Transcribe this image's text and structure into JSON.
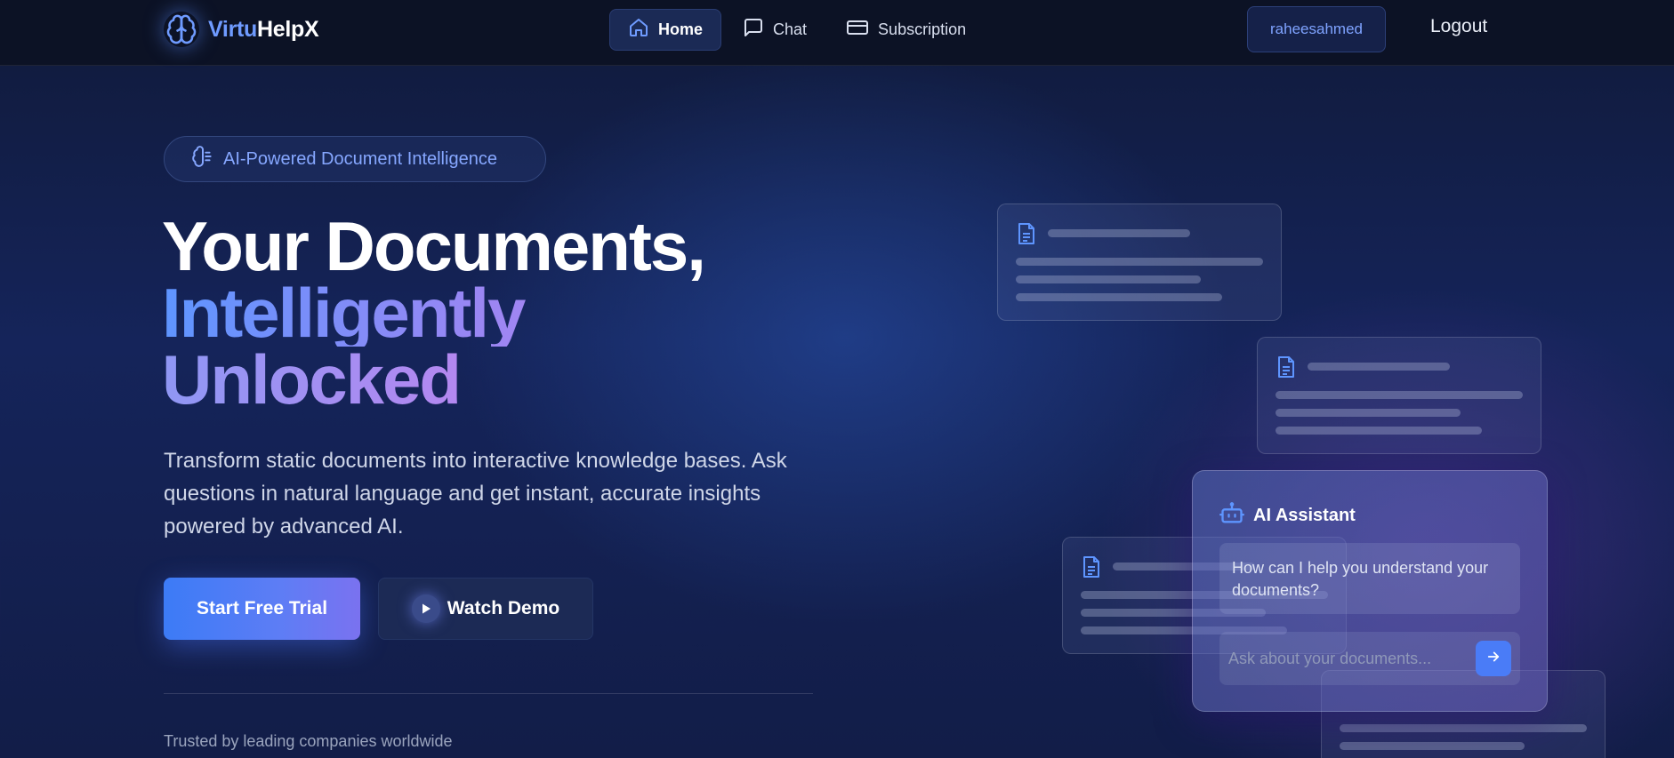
{
  "nav": {
    "logo_part1": "Virtu",
    "logo_part2": "HelpX",
    "links": [
      {
        "label": "Home",
        "icon": "home-icon",
        "active": true
      },
      {
        "label": "Chat",
        "icon": "chat-icon",
        "active": false
      },
      {
        "label": "Subscription",
        "icon": "card-icon",
        "active": false
      }
    ],
    "username": "raheesahmed",
    "logout_label": "Logout"
  },
  "hero": {
    "badge": "AI-Powered Document Intelligence",
    "title_line1": "Your Documents,",
    "title_line2": "Intelligently",
    "title_line3": "Unlocked",
    "description": "Transform static documents into interactive knowledge bases. Ask questions in natural language and get instant, accurate insights powered by advanced AI.",
    "primary_cta": "Start Free Trial",
    "secondary_cta": "Watch Demo",
    "trusted": "Trusted by leading companies worldwide"
  },
  "assistant": {
    "title": "AI Assistant",
    "message": "How can I help you understand your documents?",
    "input_placeholder": "Ask about your documents..."
  },
  "colors": {
    "accent": "#4a7cf7",
    "gradient_purple": "#b985f0",
    "nav_bg": "#0c1225"
  }
}
